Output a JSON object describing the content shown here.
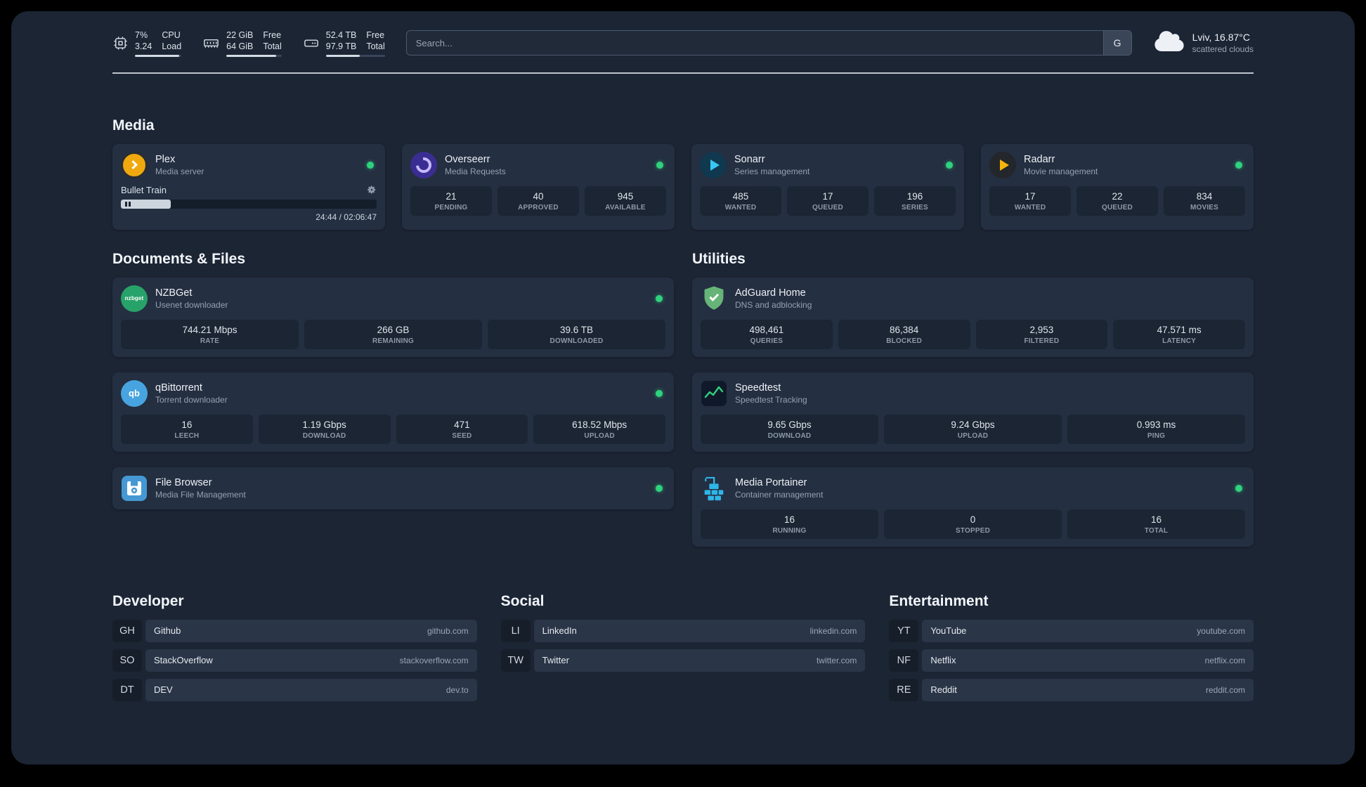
{
  "colors": {
    "background": "#1c2534",
    "card": "#242f41",
    "stat_box": "#1b2533",
    "status_online": "#2fd27d",
    "text_primary": "#eef1f6",
    "text_secondary": "#95a0b0"
  },
  "topbar": {
    "resources": [
      {
        "icon": "cpu-icon",
        "value_top": "7%",
        "value_bottom": "3.24",
        "label_top": "CPU",
        "label_bottom": "Load"
      },
      {
        "icon": "memory-icon",
        "value_top": "22 GiB",
        "value_bottom": "64 GiB",
        "label_top": "Free",
        "label_bottom": "Total"
      },
      {
        "icon": "disk-icon",
        "value_top": "52.4 TB",
        "value_bottom": "97.9 TB",
        "label_top": "Free",
        "label_bottom": "Total"
      }
    ],
    "search": {
      "placeholder": "Search...",
      "provider_button": "G"
    },
    "weather": {
      "icon": "cloud-icon",
      "location": "Lviv, 16.87°C",
      "condition": "scattered clouds"
    }
  },
  "media": {
    "title": "Media",
    "plex": {
      "icon": "plex-icon",
      "name": "Plex",
      "subtitle": "Media server",
      "status": "online",
      "now_playing": "Bullet Train",
      "time": "24:44 / 02:06:47",
      "progress_percent": 19.5
    },
    "overseerr": {
      "icon": "overseerr-icon",
      "name": "Overseerr",
      "subtitle": "Media Requests",
      "status": "online",
      "stats": [
        {
          "value": "21",
          "label": "PENDING"
        },
        {
          "value": "40",
          "label": "APPROVED"
        },
        {
          "value": "945",
          "label": "AVAILABLE"
        }
      ]
    },
    "sonarr": {
      "icon": "sonarr-icon",
      "name": "Sonarr",
      "subtitle": "Series management",
      "status": "online",
      "stats": [
        {
          "value": "485",
          "label": "WANTED"
        },
        {
          "value": "17",
          "label": "QUEUED"
        },
        {
          "value": "196",
          "label": "SERIES"
        }
      ]
    },
    "radarr": {
      "icon": "radarr-icon",
      "name": "Radarr",
      "subtitle": "Movie management",
      "status": "online",
      "stats": [
        {
          "value": "17",
          "label": "WANTED"
        },
        {
          "value": "22",
          "label": "QUEUED"
        },
        {
          "value": "834",
          "label": "MOVIES"
        }
      ]
    }
  },
  "documents": {
    "title": "Documents & Files",
    "nzbget": {
      "icon": "nzbget-icon",
      "icon_text": "nzbget",
      "name": "NZBGet",
      "subtitle": "Usenet downloader",
      "status": "online",
      "stats": [
        {
          "value": "744.21 Mbps",
          "label": "RATE"
        },
        {
          "value": "266 GB",
          "label": "REMAINING"
        },
        {
          "value": "39.6 TB",
          "label": "DOWNLOADED"
        }
      ]
    },
    "qbittorrent": {
      "icon": "qbittorrent-icon",
      "icon_text": "qb",
      "name": "qBittorrent",
      "subtitle": "Torrent downloader",
      "status": "online",
      "stats": [
        {
          "value": "16",
          "label": "LEECH"
        },
        {
          "value": "1.19 Gbps",
          "label": "DOWNLOAD"
        },
        {
          "value": "471",
          "label": "SEED"
        },
        {
          "value": "618.52 Mbps",
          "label": "UPLOAD"
        }
      ]
    },
    "filebrowser": {
      "icon": "filebrowser-icon",
      "name": "File Browser",
      "subtitle": "Media File Management",
      "status": "online"
    }
  },
  "utilities": {
    "title": "Utilities",
    "adguard": {
      "icon": "adguard-icon",
      "name": "AdGuard Home",
      "subtitle": "DNS and adblocking",
      "stats": [
        {
          "value": "498,461",
          "label": "QUERIES"
        },
        {
          "value": "86,384",
          "label": "BLOCKED"
        },
        {
          "value": "2,953",
          "label": "FILTERED"
        },
        {
          "value": "47.571 ms",
          "label": "LATENCY"
        }
      ]
    },
    "speedtest": {
      "icon": "speedtest-icon",
      "name": "Speedtest",
      "subtitle": "Speedtest Tracking",
      "stats": [
        {
          "value": "9.65 Gbps",
          "label": "DOWNLOAD"
        },
        {
          "value": "9.24 Gbps",
          "label": "UPLOAD"
        },
        {
          "value": "0.993 ms",
          "label": "PING"
        }
      ]
    },
    "portainer": {
      "icon": "portainer-icon",
      "name": "Media Portainer",
      "subtitle": "Container management",
      "status": "online",
      "stats": [
        {
          "value": "16",
          "label": "RUNNING"
        },
        {
          "value": "0",
          "label": "STOPPED"
        },
        {
          "value": "16",
          "label": "TOTAL"
        }
      ]
    }
  },
  "bookmarks": {
    "developer": {
      "title": "Developer",
      "items": [
        {
          "abbr": "GH",
          "name": "Github",
          "url": "github.com"
        },
        {
          "abbr": "SO",
          "name": "StackOverflow",
          "url": "stackoverflow.com"
        },
        {
          "abbr": "DT",
          "name": "DEV",
          "url": "dev.to"
        }
      ]
    },
    "social": {
      "title": "Social",
      "items": [
        {
          "abbr": "LI",
          "name": "LinkedIn",
          "url": "linkedin.com"
        },
        {
          "abbr": "TW",
          "name": "Twitter",
          "url": "twitter.com"
        }
      ]
    },
    "entertainment": {
      "title": "Entertainment",
      "items": [
        {
          "abbr": "YT",
          "name": "YouTube",
          "url": "youtube.com"
        },
        {
          "abbr": "NF",
          "name": "Netflix",
          "url": "netflix.com"
        },
        {
          "abbr": "RE",
          "name": "Reddit",
          "url": "reddit.com"
        }
      ]
    }
  }
}
